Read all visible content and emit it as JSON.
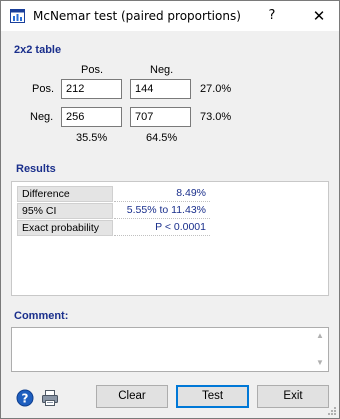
{
  "window": {
    "title": "McNemar test (paired proportions)",
    "help_label": "?",
    "close_label": "✕"
  },
  "table": {
    "heading": "2x2 table",
    "col_pos": "Pos.",
    "col_neg": "Neg.",
    "row_pos": "Pos.",
    "row_neg": "Neg.",
    "cell_pos_pos": "212",
    "cell_pos_neg": "144",
    "cell_neg_pos": "256",
    "cell_neg_neg": "707",
    "row_pos_pct": "27.0%",
    "row_neg_pct": "73.0%",
    "col_pos_pct": "35.5%",
    "col_neg_pct": "64.5%"
  },
  "results": {
    "heading": "Results",
    "rows": [
      {
        "label": "Difference",
        "value": "8.49%"
      },
      {
        "label": "95% CI",
        "value": "5.55% to 11.43%"
      },
      {
        "label": "Exact probability",
        "value": "P < 0.0001"
      }
    ]
  },
  "comment": {
    "heading": "Comment:",
    "value": ""
  },
  "buttons": {
    "clear": "Clear",
    "test": "Test",
    "exit": "Exit"
  },
  "colors": {
    "heading": "#1a2f8c",
    "default_button_border": "#0078d7"
  },
  "icons": {
    "app": "table-chart-icon",
    "help": "help-circle-icon",
    "print": "printer-icon"
  }
}
